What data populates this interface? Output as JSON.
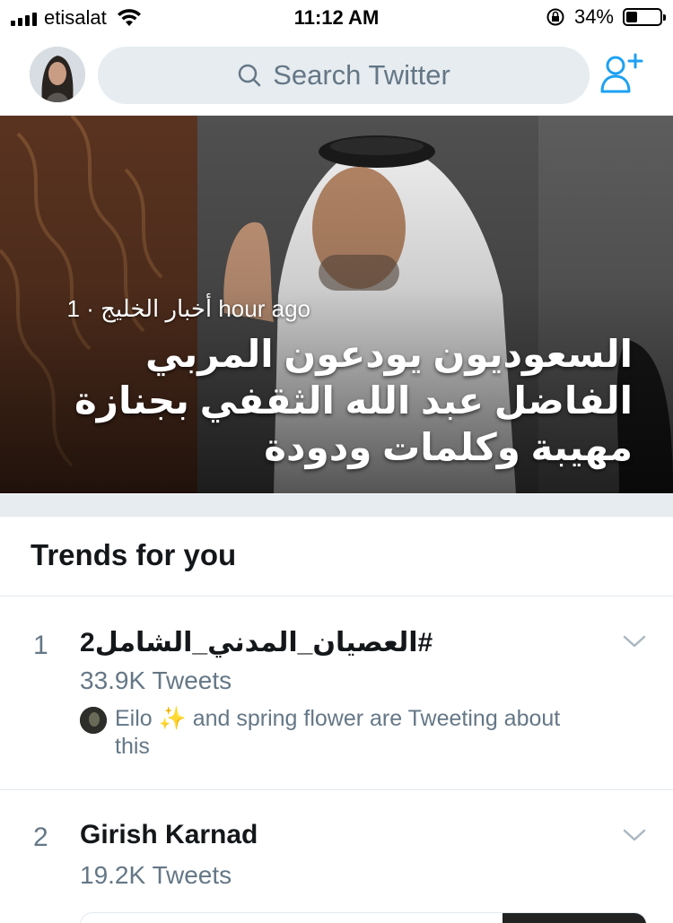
{
  "status_bar": {
    "carrier": "etisalat",
    "time": "11:12 AM",
    "battery": "34%",
    "battery_level": 0.34
  },
  "header": {
    "search_placeholder": "Search Twitter"
  },
  "hero": {
    "source": "أخبار الخليج",
    "separator": " · ",
    "time": "1 hour ago",
    "title": "السعوديون يودعون المربي الفاضل عبد الله الثقفي بجنازة مهيبة وكلمات ودودة"
  },
  "trends": {
    "title": "Trends for you",
    "items": [
      {
        "rank": "1",
        "name": "#العصيان_المدني_الشامل2",
        "count": "33.9K Tweets",
        "context": "Eilo ✨ and spring flower are Tweeting about this"
      },
      {
        "rank": "2",
        "name": "Girish Karnad",
        "count": "19.2K Tweets"
      }
    ]
  },
  "colors": {
    "accent": "#1da1f2",
    "secondary_text": "#657786",
    "separator": "#e6ecf0"
  },
  "icons": [
    "search-icon",
    "add-user-icon",
    "wifi-icon",
    "rotation-lock-icon",
    "chevron-down-icon"
  ]
}
